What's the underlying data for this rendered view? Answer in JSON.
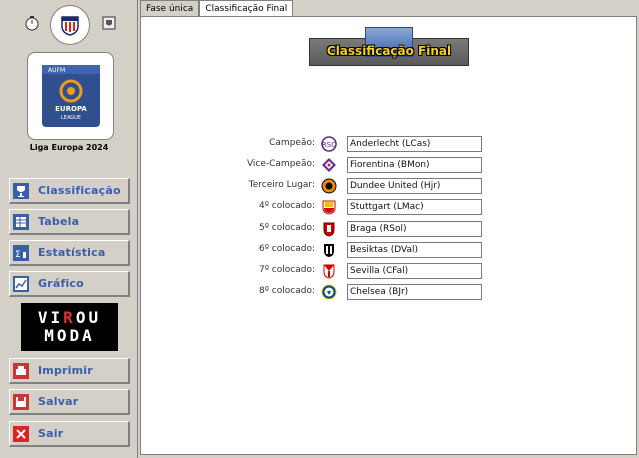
{
  "sidebar": {
    "league_name": "Liga Europa 2024",
    "buttons": [
      {
        "label": "Classificação",
        "icon": "trophy-icon"
      },
      {
        "label": "Tabela",
        "icon": "table-icon"
      },
      {
        "label": "Estatística",
        "icon": "statistics-icon"
      },
      {
        "label": "Gráfico",
        "icon": "chart-icon"
      },
      {
        "label": "Imprimir",
        "icon": "printer-icon"
      },
      {
        "label": "Salvar",
        "icon": "save-icon"
      },
      {
        "label": "Sair",
        "icon": "close-icon"
      }
    ],
    "sponsor": {
      "line1a": "VI",
      "line1b": "R",
      "line1c": "OU",
      "line2": "MODA"
    },
    "logo_text": {
      "top": "AUFM",
      "mid1": "EUROPA",
      "mid2": "LEAGUE"
    }
  },
  "tabs": [
    {
      "label": "Fase única",
      "active": false
    },
    {
      "label": "Classificação Final",
      "active": true
    }
  ],
  "title": "Classificação Final",
  "standings": [
    {
      "position": "Campeão:",
      "team": "Anderlecht (LCas)",
      "badge": "anderlecht-badge-icon"
    },
    {
      "position": "Vice-Campeão:",
      "team": "Fiorentina (BMon)",
      "badge": "fiorentina-badge-icon"
    },
    {
      "position": "Terceiro Lugar:",
      "team": "Dundee United (Hjr)",
      "badge": "dundee-united-badge-icon"
    },
    {
      "position": "4º colocado:",
      "team": "Stuttgart (LMac)",
      "badge": "stuttgart-badge-icon"
    },
    {
      "position": "5º colocado:",
      "team": "Braga (RSol)",
      "badge": "braga-badge-icon"
    },
    {
      "position": "6º colocado:",
      "team": "Besiktas (DVal)",
      "badge": "besiktas-badge-icon"
    },
    {
      "position": "7º colocado:",
      "team": "Sevilla (CFal)",
      "badge": "sevilla-badge-icon"
    },
    {
      "position": "8º colocado:",
      "team": "Chelsea (BJr)",
      "badge": "chelsea-badge-icon"
    }
  ],
  "colors": {
    "button_text": "#3a5fa8",
    "title_text": "#f5d01a",
    "background": "#d4d0c8"
  }
}
